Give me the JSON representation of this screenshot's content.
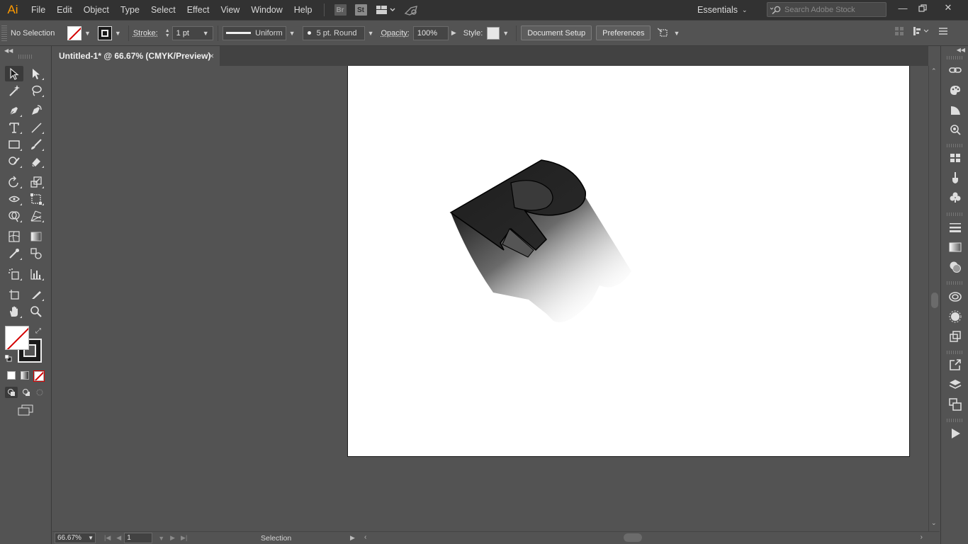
{
  "app": {
    "logo": "Ai",
    "menu": [
      "File",
      "Edit",
      "Object",
      "Type",
      "Select",
      "Effect",
      "View",
      "Window",
      "Help"
    ],
    "bridge_badge": "Br",
    "stock_badge": "St",
    "workspace": "Essentials",
    "search_placeholder": "Search Adobe Stock"
  },
  "control_bar": {
    "selection_label": "No Selection",
    "stroke_label": "Stroke:",
    "stroke_weight": "1 pt",
    "profile_label": "Uniform",
    "brush_label": "5 pt. Round",
    "opacity_label": "Opacity:",
    "opacity_value": "100%",
    "style_label": "Style:",
    "document_setup": "Document Setup",
    "preferences": "Preferences"
  },
  "document": {
    "tab_title": "Untitled-1* @ 66.67% (CMYK/Preview)",
    "close_glyph": "×"
  },
  "status_bar": {
    "zoom": "66.67%",
    "artboard_number": "1",
    "current_tool": "Selection"
  },
  "colors": {
    "accent_logo": "#ff9a00",
    "ui_dark": "#323232",
    "ui_mid": "#535353",
    "artboard": "#ffffff",
    "none_slash": "#d40000"
  },
  "tools": [
    "selection-tool",
    "direct-selection-tool",
    "magic-wand-tool",
    "lasso-tool",
    "pen-tool",
    "curvature-tool",
    "type-tool",
    "line-segment-tool",
    "rectangle-tool",
    "paintbrush-tool",
    "shaper-tool",
    "eraser-tool",
    "rotate-tool",
    "scale-tool",
    "width-tool",
    "free-transform-tool",
    "shape-builder-tool",
    "perspective-grid-tool",
    "mesh-tool",
    "gradient-tool",
    "eyedropper-tool",
    "blend-tool",
    "symbol-sprayer-tool",
    "column-graph-tool",
    "artboard-tool",
    "slice-tool",
    "hand-tool",
    "zoom-tool"
  ],
  "dock_panels": [
    "links-icon",
    "color-guide-icon",
    "color-icon",
    "appearance-icon",
    "swatches-icon",
    "brushes-icon",
    "symbols-icon",
    "stroke-icon",
    "gradient-icon",
    "transparency-icon",
    "libraries-icon",
    "graphic-styles-icon",
    "asset-export-icon",
    "export-icon",
    "layers-icon",
    "artboards-icon",
    "actions-icon"
  ]
}
